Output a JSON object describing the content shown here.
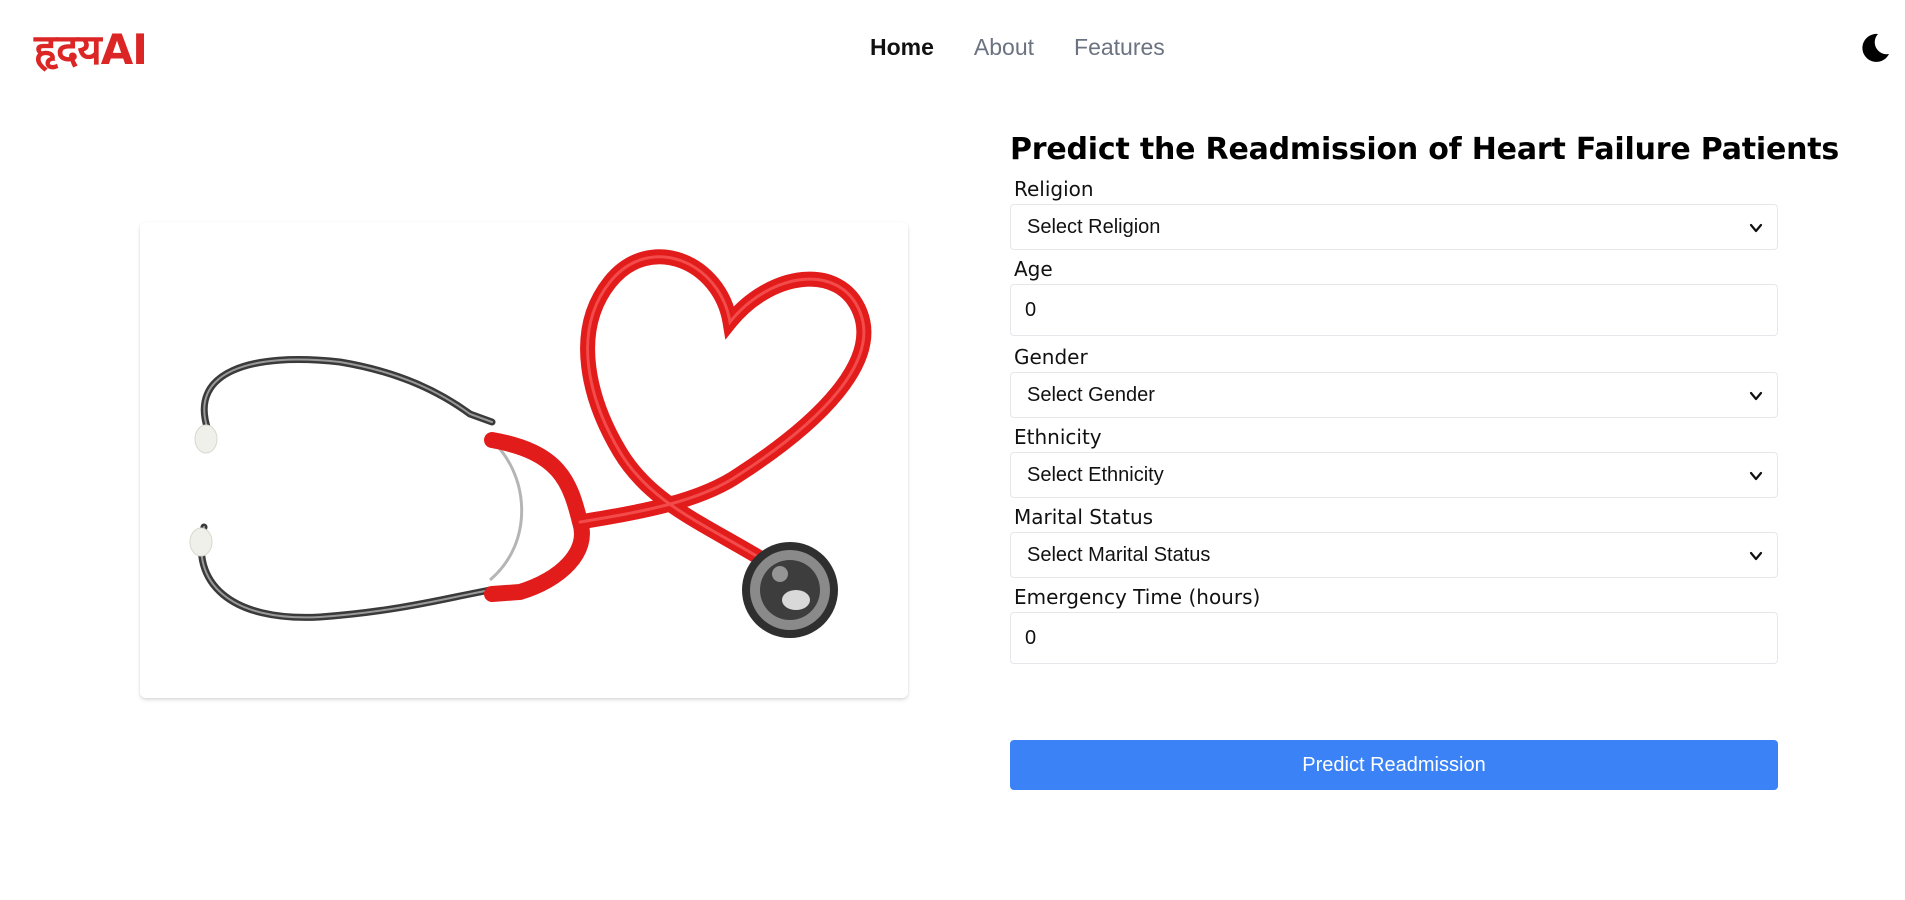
{
  "brand": {
    "logo_text": "हृदयAI",
    "color": "#dc2626"
  },
  "nav": {
    "items": [
      {
        "label": "Home",
        "active": true
      },
      {
        "label": "About",
        "active": false
      },
      {
        "label": "Features",
        "active": false
      }
    ],
    "theme_toggle_icon": "moon-icon"
  },
  "hero_image": {
    "subject": "stethoscope-heart-image"
  },
  "form": {
    "title": "Predict the Readmission of Heart Failure Patients",
    "religion": {
      "label": "Religion",
      "selected": "Select Religion"
    },
    "age": {
      "label": "Age",
      "value": "0"
    },
    "gender": {
      "label": "Gender",
      "selected": "Select Gender"
    },
    "ethnicity": {
      "label": "Ethnicity",
      "selected": "Select Ethnicity"
    },
    "marital_status": {
      "label": "Marital Status",
      "selected": "Select Marital Status"
    },
    "emergency_time": {
      "label": "Emergency Time (hours)",
      "value": "0"
    },
    "submit_label": "Predict Readmission"
  },
  "colors": {
    "accent": "#3b82f6",
    "brand": "#dc2626",
    "border": "#e5e7eb"
  }
}
